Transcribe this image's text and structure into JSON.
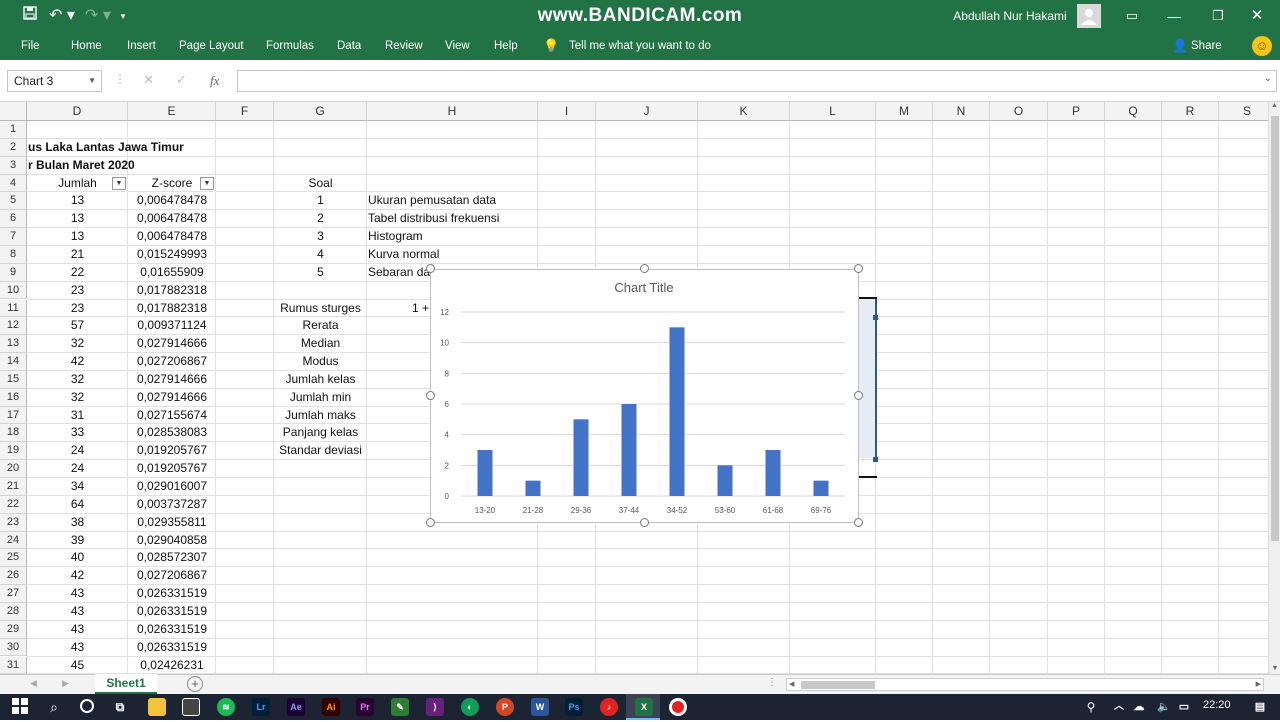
{
  "watermark": "www.BANDICAM.com",
  "titlebar": {
    "user": "Abdullah Nur Hakami"
  },
  "ribbon": {
    "tabs": [
      "File",
      "Home",
      "Insert",
      "Page Layout",
      "Formulas",
      "Data",
      "Review",
      "View",
      "Help"
    ],
    "tell_me": "Tell me what you want to do",
    "share": "Share"
  },
  "formula_bar": {
    "name_box": "Chart 3",
    "fx": "fx",
    "content": ""
  },
  "columns": [
    "D",
    "E",
    "F",
    "G",
    "H",
    "I",
    "J",
    "K",
    "L",
    "M",
    "N",
    "O",
    "P",
    "Q",
    "R",
    "S"
  ],
  "rows": [
    "1",
    "2",
    "3",
    "4",
    "5",
    "6",
    "7",
    "8",
    "9",
    "10",
    "11",
    "12",
    "13",
    "14",
    "15",
    "16",
    "17",
    "18",
    "19",
    "20",
    "21",
    "22",
    "23",
    "24",
    "25",
    "26",
    "27",
    "28",
    "29",
    "30",
    "31"
  ],
  "title_lines": [
    "us Laka Lantas Jawa Timur",
    "r Bulan Maret 2020"
  ],
  "headers": {
    "jumlah": "Jumlah",
    "zscore": "Z-score",
    "soal": "Soal"
  },
  "jumlah": [
    "13",
    "13",
    "13",
    "21",
    "22",
    "23",
    "23",
    "57",
    "32",
    "42",
    "32",
    "32",
    "31",
    "33",
    "24",
    "24",
    "34",
    "64",
    "38",
    "39",
    "40",
    "42",
    "43",
    "43",
    "43",
    "43",
    "45"
  ],
  "zscore": [
    "0,006478478",
    "0,006478478",
    "0,006478478",
    "0,015249993",
    "0,01655909",
    "0,017882318",
    "0,017882318",
    "0,009371124",
    "0,027914666",
    "0,027206867",
    "0,027914666",
    "0,027914666",
    "0,027155674",
    "0,028538083",
    "0,019205767",
    "0,019205767",
    "0,029016007",
    "0,003737287",
    "0,029355811",
    "0,029040858",
    "0,028572307",
    "0,027206867",
    "0,026331519",
    "0,026331519",
    "0,026331519",
    "0,026331519",
    "0,02426231"
  ],
  "soal": [
    {
      "no": "1",
      "text": "Ukuran pemusatan data"
    },
    {
      "no": "2",
      "text": "Tabel distribusi frekuensi"
    },
    {
      "no": "3",
      "text": "Histogram"
    },
    {
      "no": "4",
      "text": "Kurva normal"
    },
    {
      "no": "5",
      "text": "Sebaran da"
    }
  ],
  "stats_labels": [
    "Rumus sturges",
    "Rerata",
    "Median",
    "Modus",
    "Jumlah kelas",
    "Jumlah min",
    "Jumlah maks",
    "Panjang kelas",
    "Standar deviasi"
  ],
  "sturges_partial": "1 +",
  "sheet": {
    "tab": "Sheet1"
  },
  "taskbar": {
    "time": "22:20"
  },
  "colors": {
    "excel_green": "#217346",
    "bar": "#4472c4"
  },
  "chart_data": {
    "type": "bar",
    "title": "Chart Title",
    "categories": [
      "13-20",
      "21-28",
      "29-36",
      "37-44",
      "34-52",
      "53-60",
      "61-68",
      "69-76"
    ],
    "values": [
      3,
      1,
      5,
      6,
      11,
      2,
      3,
      1
    ],
    "ylim": [
      0,
      12
    ],
    "yticks": [
      "0",
      "2",
      "4",
      "6",
      "8",
      "10",
      "12"
    ],
    "grid": true
  }
}
